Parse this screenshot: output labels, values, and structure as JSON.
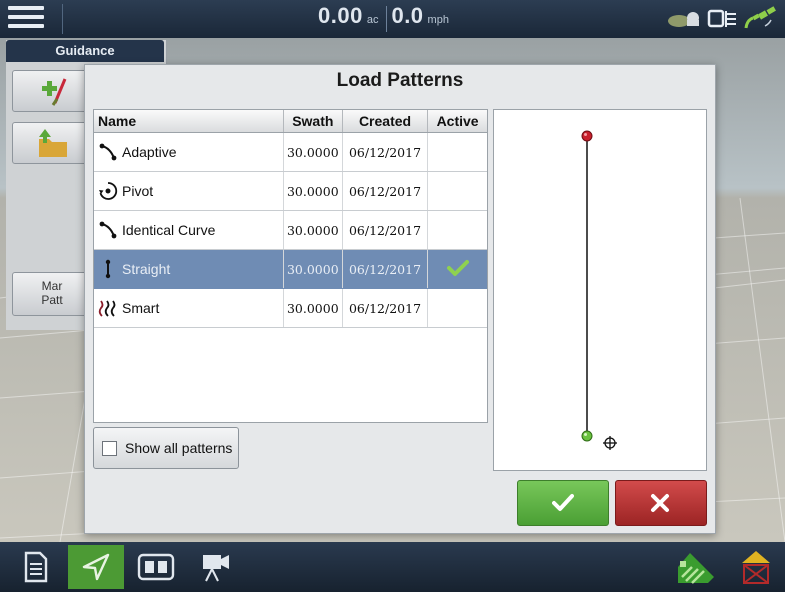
{
  "topbar": {
    "area_value": "0.00",
    "area_unit": "ac",
    "speed_value": "0.0",
    "speed_unit": "mph"
  },
  "left_panel": {
    "tab_label": "Guidance",
    "manage_label_line1": "Mar",
    "manage_label_line2": "Patt"
  },
  "dialog": {
    "title": "Load Patterns",
    "columns": [
      "Name",
      "Swath",
      "Created",
      "Active"
    ],
    "rows": [
      {
        "icon": "adaptive-pattern-icon",
        "name": "Adaptive",
        "swath": "30.0000",
        "created": "06/12/2017",
        "active": false
      },
      {
        "icon": "pivot-pattern-icon",
        "name": "Pivot",
        "swath": "30.0000",
        "created": "06/12/2017",
        "active": false
      },
      {
        "icon": "identical-curve-pattern-icon",
        "name": "Identical Curve",
        "swath": "30.0000",
        "created": "06/12/2017",
        "active": false
      },
      {
        "icon": "straight-pattern-icon",
        "name": "Straight",
        "swath": "30.0000",
        "created": "06/12/2017",
        "active": true
      },
      {
        "icon": "smart-pattern-icon",
        "name": "Smart",
        "swath": "30.0000",
        "created": "06/12/2017",
        "active": false
      }
    ],
    "selected_row": 3,
    "show_all_label": "Show all patterns",
    "show_all_checked": false
  },
  "colors": {
    "ok": "#4a9f34",
    "cancel": "#9c2424",
    "selection": "#6f8cb4"
  }
}
